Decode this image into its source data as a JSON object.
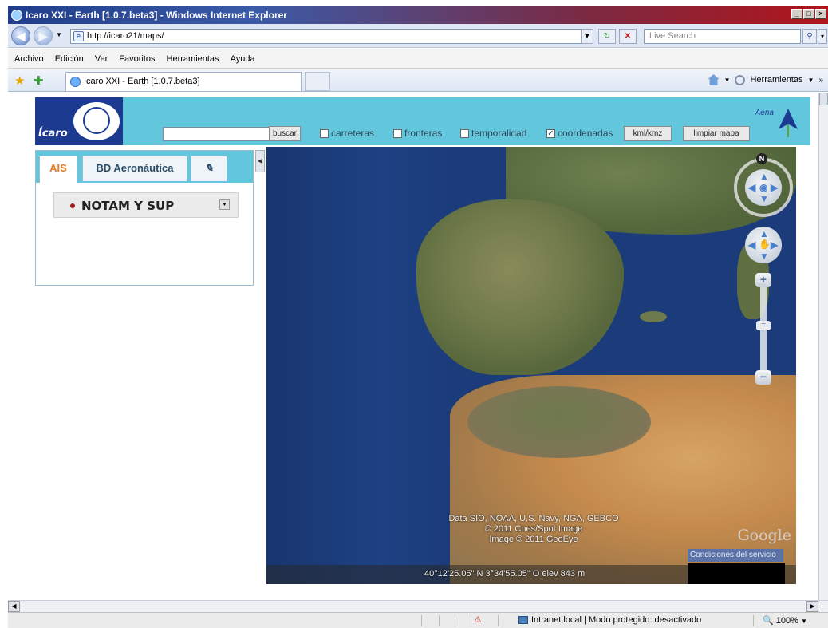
{
  "browser": {
    "title": "Icaro XXI - Earth [1.0.7.beta3] - Windows Internet Explorer",
    "url": "http://icaro21/maps/",
    "search_placeholder": "Live Search",
    "menu": [
      "Archivo",
      "Edición",
      "Ver",
      "Favoritos",
      "Herramientas",
      "Ayuda"
    ],
    "tab_title": "Icaro XXI - Earth [1.0.7.beta3]",
    "tools_label": "Herramientas",
    "status_zone": "Intranet local | Modo protegido: desactivado",
    "zoom": "100%"
  },
  "app": {
    "logo_text": "Ícaro",
    "search_button": "buscar",
    "checkboxes": [
      {
        "label": "carreteras",
        "checked": false
      },
      {
        "label": "fronteras",
        "checked": false
      },
      {
        "label": "temporalidad",
        "checked": false
      },
      {
        "label": "coordenadas",
        "checked": true
      }
    ],
    "kml_button": "kml/kmz",
    "clear_button": "limpiar mapa",
    "brand": "Aena"
  },
  "panel": {
    "tabs": [
      "AIS",
      "BD Aeronáutica"
    ],
    "active_tab": "AIS",
    "item": "NOTAM Y SUP"
  },
  "map": {
    "credits": [
      "Data SIO, NOAA, U.S. Navy, NGA, GEBCO",
      "© 2011 Cnes/Spot Image",
      "Image © 2011 GeoEye"
    ],
    "google": "Google",
    "terms": "Condiciones del servicio",
    "coords": "40°12'25.05\" N   3°34'55.05\" O  elev  843 m",
    "north": "N"
  }
}
